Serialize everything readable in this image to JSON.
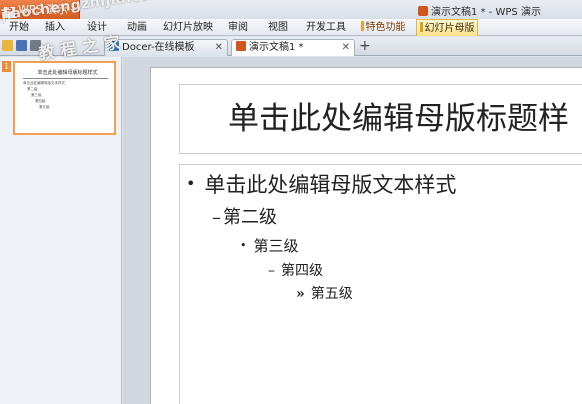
{
  "app": {
    "name": "WPS 演示",
    "window_title": "演示文稿1 * - WPS 演示"
  },
  "ribbon_tabs": [
    {
      "label": "开始"
    },
    {
      "label": "插入"
    },
    {
      "label": "设计"
    },
    {
      "label": "动画"
    },
    {
      "label": "幻灯片放映"
    },
    {
      "label": "审阅"
    },
    {
      "label": "视图"
    },
    {
      "label": "开发工具"
    },
    {
      "label": "特色功能"
    },
    {
      "label": "幻灯片母版"
    }
  ],
  "doc_tabs": [
    {
      "label": "Docer-在线模板",
      "close": "✕"
    },
    {
      "label": "演示文稿1 *",
      "close": "✕"
    }
  ],
  "add_tab": "+",
  "thumbnail": {
    "number": "1",
    "title": "单击此处编辑母版标题样式",
    "lines": [
      "单击此处编辑母版文本样式",
      "第二级",
      "第三级",
      "第四级",
      "第五级"
    ]
  },
  "slide": {
    "title": "单击此处编辑母版标题样",
    "levels": [
      {
        "bullet": "•",
        "text": "单击此处编辑母版文本样式"
      },
      {
        "bullet": "–",
        "text": "第二级"
      },
      {
        "bullet": "•",
        "text": "第三级"
      },
      {
        "bullet": "–",
        "text": "第四级"
      },
      {
        "bullet": "»",
        "text": "第五级"
      }
    ]
  },
  "watermark": {
    "text_en": "jiaochengzhijia.com",
    "text_cn": "教程之家"
  },
  "colors": {
    "app_button": "#d35b1f",
    "active_tab": "#ffe08a",
    "thumbnail_border": "#f0a050"
  }
}
